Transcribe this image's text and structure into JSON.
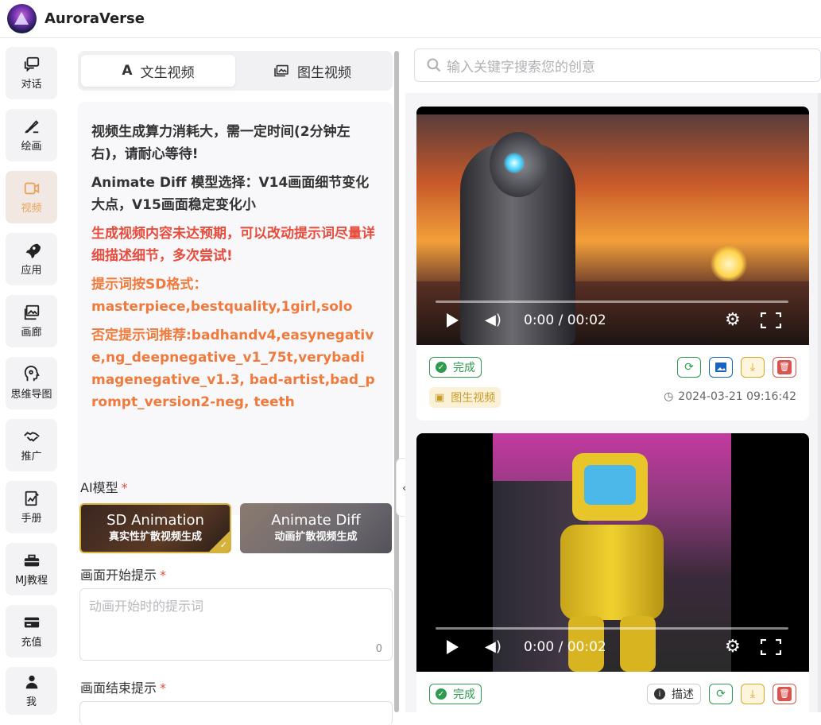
{
  "app": {
    "title": "AuroraVerse"
  },
  "sidebar": {
    "items": [
      {
        "label": "对话",
        "icon": "chat-icon"
      },
      {
        "label": "绘画",
        "icon": "brush-icon"
      },
      {
        "label": "视频",
        "icon": "video-icon",
        "active": true
      },
      {
        "label": "应用",
        "icon": "rocket-icon"
      },
      {
        "label": "画廊",
        "icon": "gallery-icon"
      },
      {
        "label": "思维导图",
        "icon": "mindmap-icon"
      },
      {
        "label": "推广",
        "icon": "handshake-icon"
      },
      {
        "label": "手册",
        "icon": "manual-icon"
      },
      {
        "label": "MJ教程",
        "icon": "toolbox-icon"
      },
      {
        "label": "充值",
        "icon": "card-icon"
      },
      {
        "label": "我",
        "icon": "user-icon"
      }
    ]
  },
  "tabs": [
    {
      "label": "文生视频",
      "selected": true
    },
    {
      "label": "图生视频",
      "selected": false
    }
  ],
  "notes": {
    "line1": "视频生成算力消耗大，需一定时间(2分钟左右)，请耐心等待!",
    "line2": "Animate Diff 模型选择：V14画面细节变化大点，V15画面稳定变化小",
    "line3": "生成视频内容未达预期，可以改动提示词尽量详细描述细节，多次尝试!",
    "line4": "提示词按SD格式：masterpiece,bestquality,1girl,solo",
    "line5": "否定提示词推荐:badhandv4,easynegative,ng_deepnegative_v1_75t,verybadimagenegative_v1.3, bad-artist,bad_prompt_version2-neg, teeth"
  },
  "form": {
    "model_label": "AI模型",
    "required_mark": "*",
    "models": [
      {
        "name": "SD Animation",
        "desc": "真实性扩散视频生成",
        "selected": true
      },
      {
        "name": "Animate Diff",
        "desc": "动画扩散视频生成",
        "selected": false
      }
    ],
    "start_label": "画面开始提示",
    "start_placeholder": "动画开始时的提示词",
    "start_count": "0",
    "end_label": "画面结束提示"
  },
  "search": {
    "placeholder": "输入关键字搜索您的创意"
  },
  "cards": [
    {
      "time": "0:00 / 00:02",
      "status": "完成",
      "type": "图生视频",
      "date": "2024-03-21 09:16:42"
    },
    {
      "time": "0:00 / 00:02",
      "status": "完成",
      "describe": "描述"
    }
  ],
  "colors": {
    "accent": "#e8a35a",
    "success": "#2e9b4e",
    "danger": "#d9534f",
    "orange": "#f07a3c",
    "red": "#e74c3c"
  }
}
